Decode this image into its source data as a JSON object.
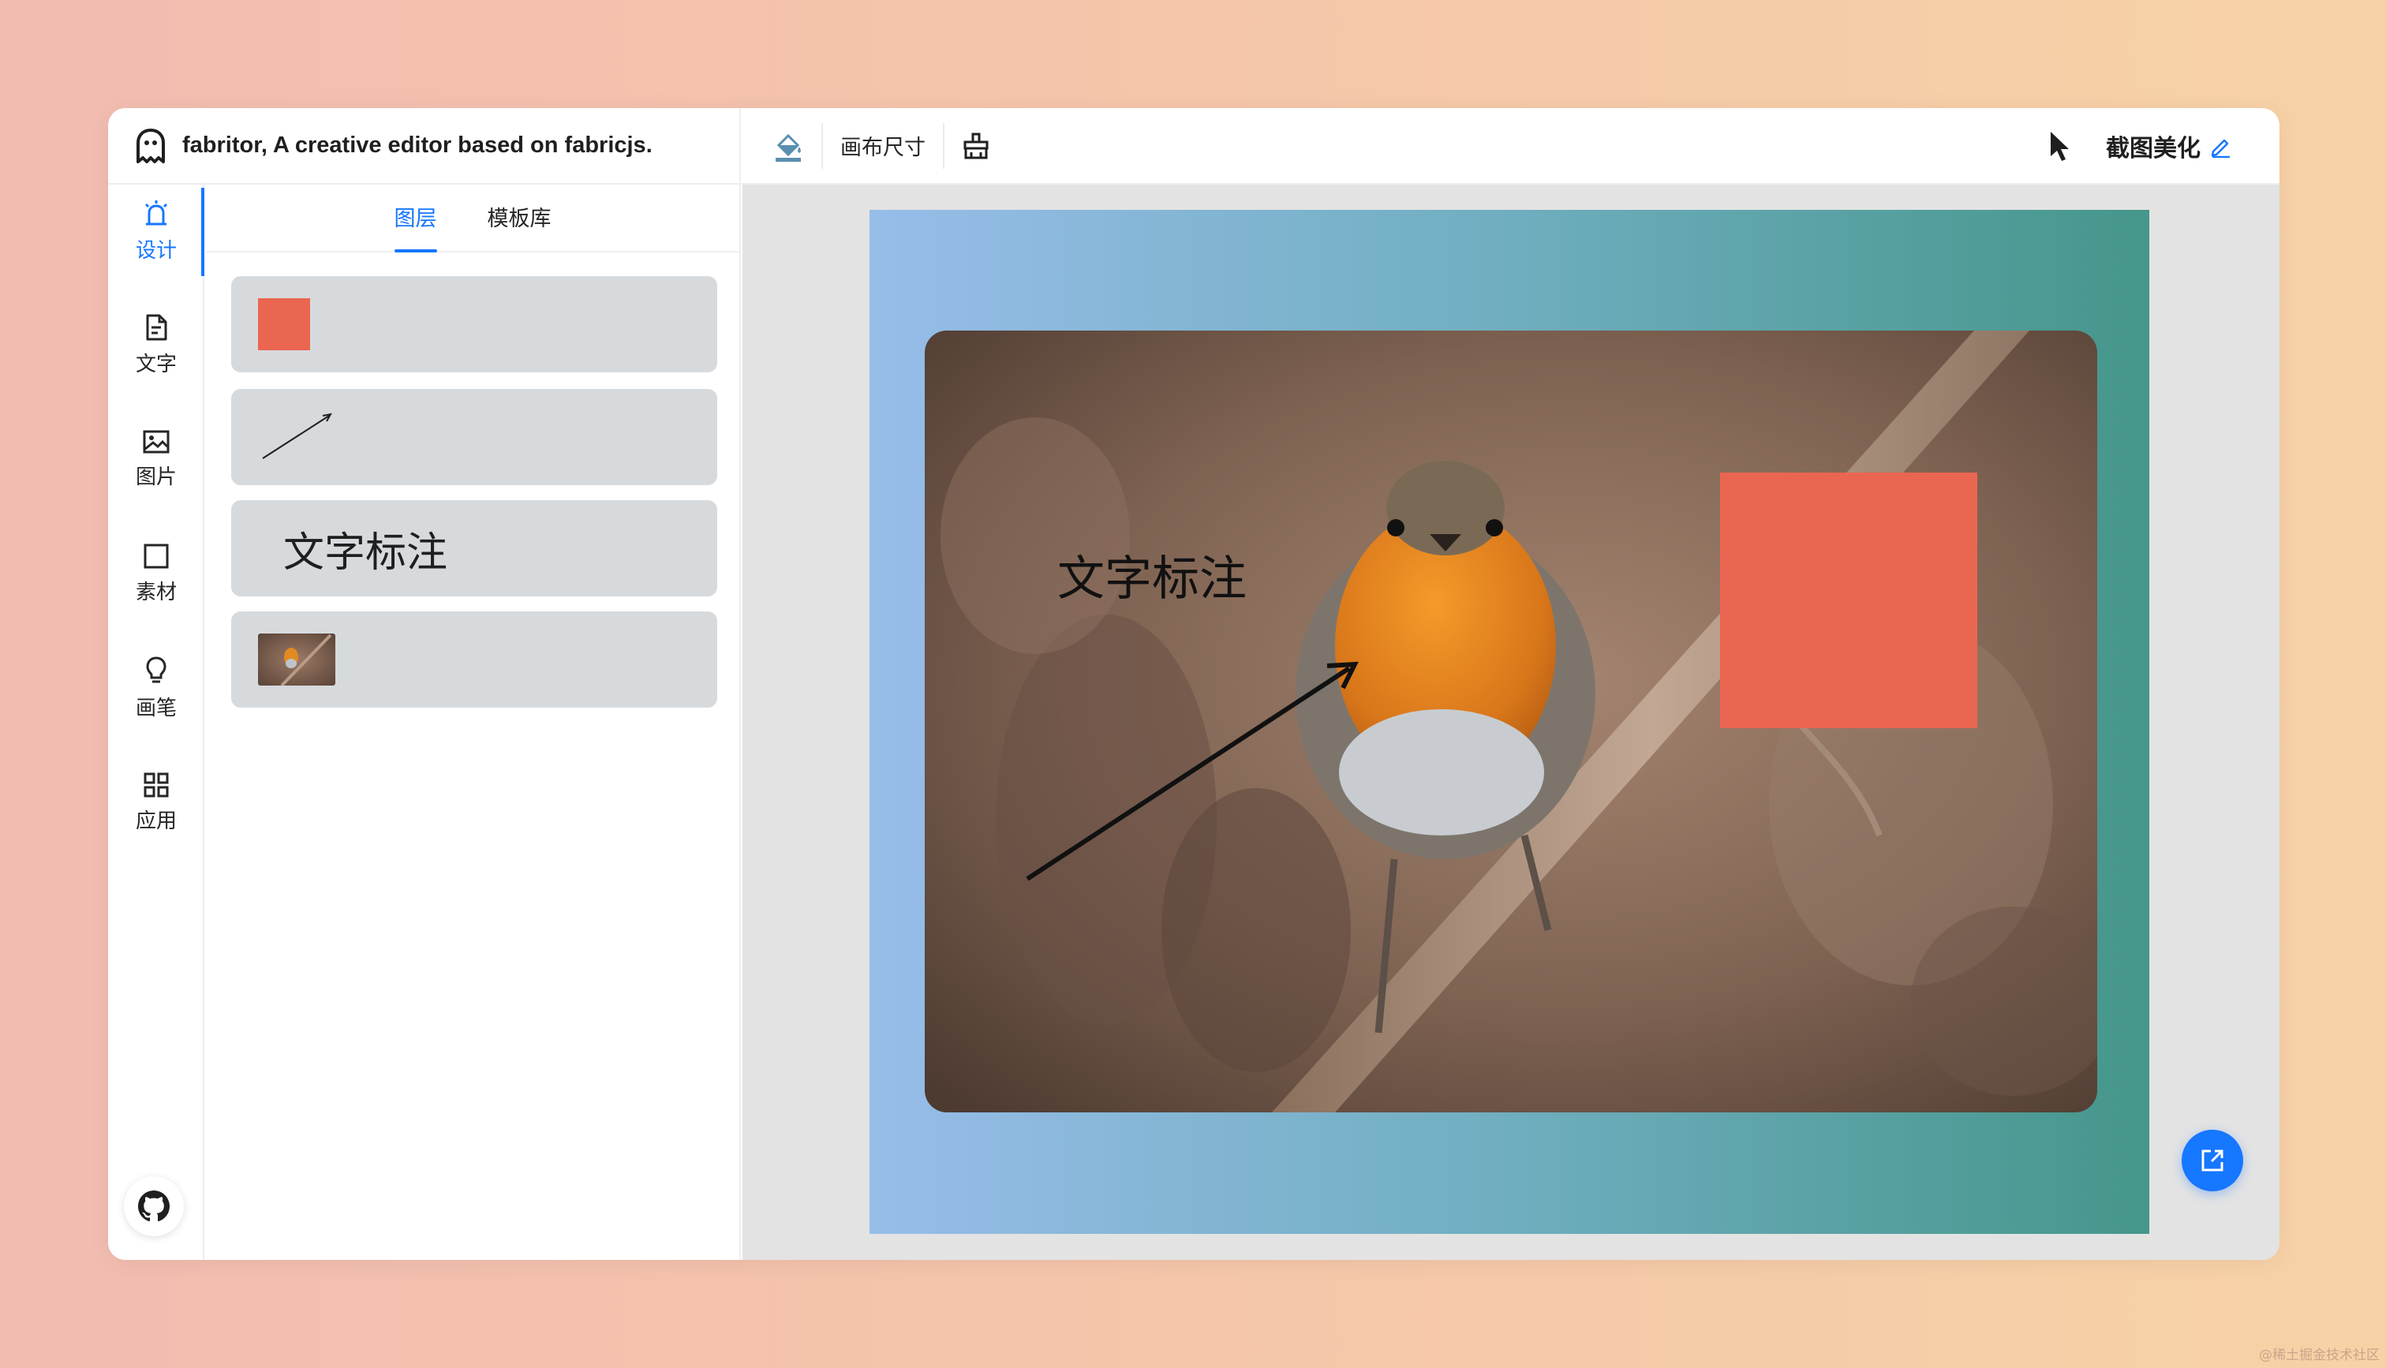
{
  "app": {
    "title": "fabritor, A creative editor based on fabricjs."
  },
  "toolbar": {
    "canvas_size_label": "画布尺寸",
    "doc_title": "截图美化",
    "icons": [
      "fill-bucket-icon",
      "broom-clear-icon",
      "pointer-cursor-icon",
      "pencil-edit-icon"
    ]
  },
  "nav": {
    "items": [
      {
        "label": "设计",
        "icon": "design-icon",
        "active": true
      },
      {
        "label": "文字",
        "icon": "text-file-icon",
        "active": false
      },
      {
        "label": "图片",
        "icon": "image-icon",
        "active": false
      },
      {
        "label": "素材",
        "icon": "square-shape-icon",
        "active": false
      },
      {
        "label": "画笔",
        "icon": "bulb-brush-icon",
        "active": false
      },
      {
        "label": "应用",
        "icon": "apps-grid-icon",
        "active": false
      }
    ]
  },
  "panel": {
    "tabs": [
      {
        "label": "图层",
        "active": true
      },
      {
        "label": "模板库",
        "active": false
      }
    ],
    "layers": [
      {
        "type": "rect"
      },
      {
        "type": "arrow-line"
      },
      {
        "type": "text",
        "text": "文字标注"
      },
      {
        "type": "image"
      }
    ]
  },
  "canvas": {
    "annotation_text": "文字标注"
  },
  "colors": {
    "accent": "#1677ff",
    "annotation_rect": "#ea6651",
    "gradient_start": "#97bde9",
    "gradient_end": "#45968b"
  },
  "watermark": "@稀土掘金技术社区"
}
